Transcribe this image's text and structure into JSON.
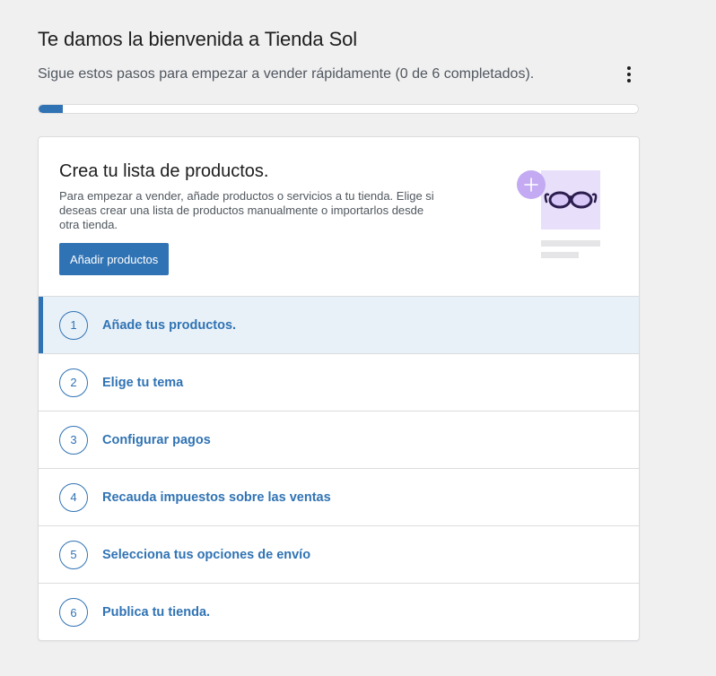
{
  "header": {
    "title": "Te damos la bienvenida a Tienda Sol",
    "subtitle": "Sigue estos pasos para empezar a vender rápidamente (0 de 6 completados).",
    "menu_icon": "vertical-ellipsis-icon"
  },
  "progress": {
    "completed": 0,
    "total": 6,
    "fill_fraction": 0.04,
    "fill_color": "#3073b4"
  },
  "hero": {
    "title": "Crea tu lista de productos.",
    "description": "Para empezar a vender, añade productos o servicios a tu tienda. Elige si deseas crear una lista de productos manualmente o importarlos desde otra tienda.",
    "button_label": "Añadir productos",
    "illustration": "glasses-product-illustration"
  },
  "steps": [
    {
      "number": "1",
      "label": "Añade tus productos.",
      "active": true
    },
    {
      "number": "2",
      "label": "Elige tu tema",
      "active": false
    },
    {
      "number": "3",
      "label": "Configurar pagos",
      "active": false
    },
    {
      "number": "4",
      "label": "Recauda impuestos sobre las ventas",
      "active": false
    },
    {
      "number": "5",
      "label": "Selecciona tus opciones de envío",
      "active": false
    },
    {
      "number": "6",
      "label": "Publica tu tienda.",
      "active": false
    }
  ],
  "colors": {
    "accent": "#3073b4",
    "background": "#f0f0f1",
    "active_row": "#e9f1f8",
    "illustration_purple": "#c3aaf2"
  }
}
